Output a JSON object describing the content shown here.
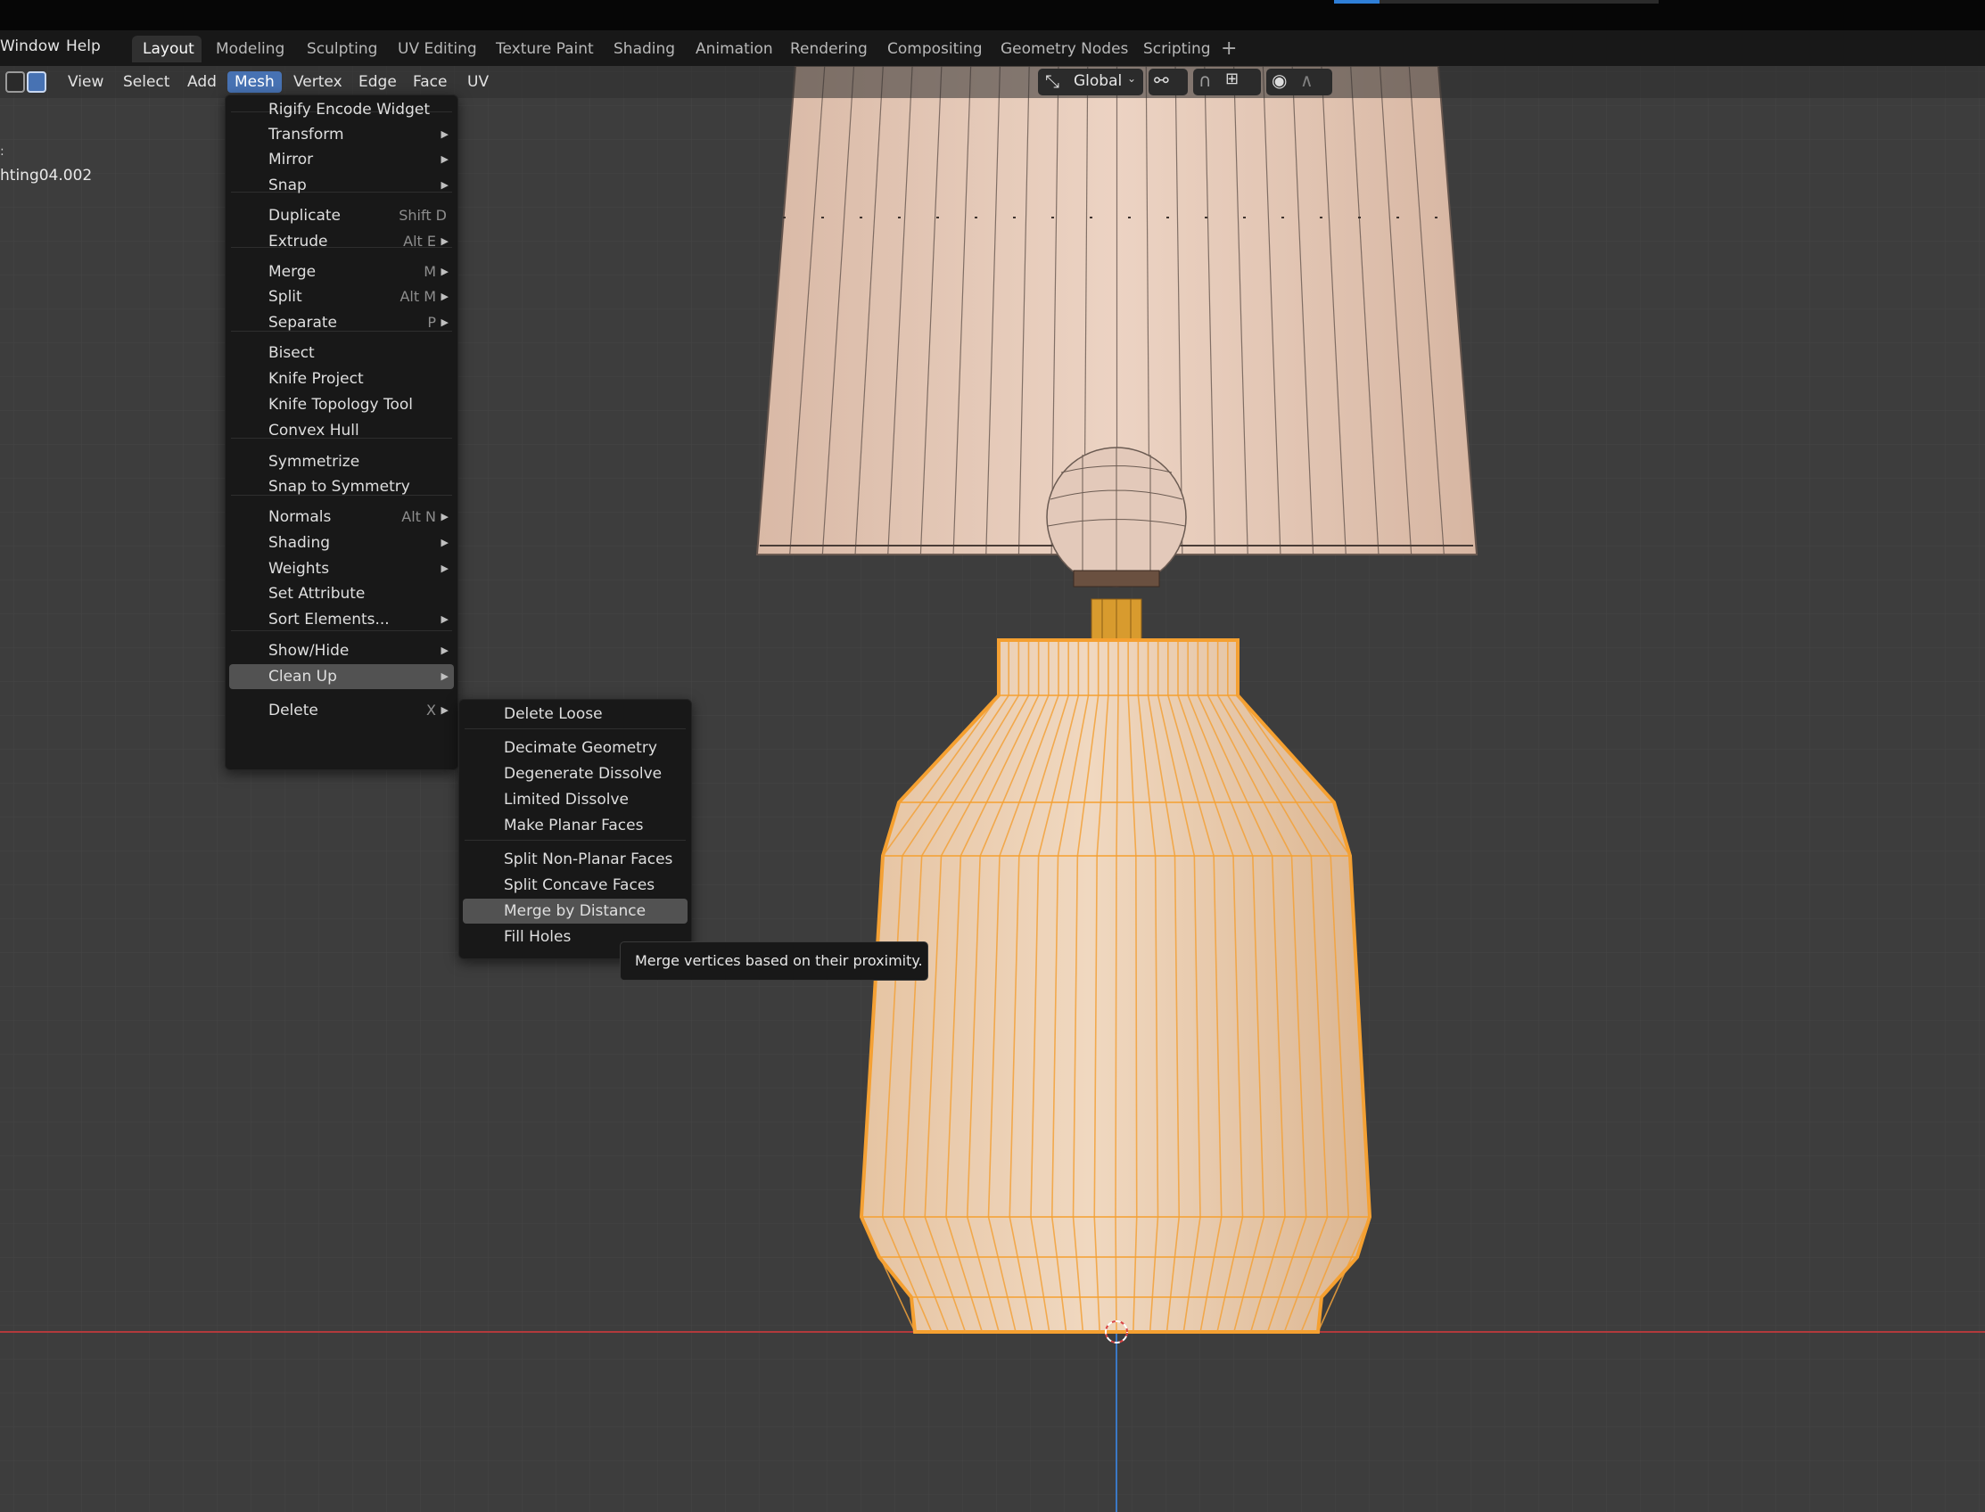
{
  "topbar": {
    "progress_fraction": 0.14
  },
  "menubar": {
    "left_items": [
      "Window",
      "Help"
    ],
    "workspace_tabs": [
      "Layout",
      "Modeling",
      "Sculpting",
      "UV Editing",
      "Texture Paint",
      "Shading",
      "Animation",
      "Rendering",
      "Compositing",
      "Geometry Nodes",
      "Scripting"
    ],
    "active_tab": "Layout",
    "add_icon": "plus-icon"
  },
  "viewport_header": {
    "menus": [
      "View",
      "Select",
      "Add",
      "Mesh",
      "Vertex",
      "Edge",
      "Face",
      "UV"
    ],
    "open_menu": "Mesh",
    "transform_orientation": "Global",
    "icons": [
      "vertex-select-icon",
      "edge-select-icon",
      "transform-orientation-icon",
      "pivot-icon",
      "snap-icon",
      "snap-target-icon",
      "proportional-edit-icon",
      "falloff-icon"
    ]
  },
  "viewport": {
    "object_name": "hting04.002",
    "left_mark": ":",
    "colors": {
      "selection": "#f5a030",
      "axis_x": "#c0393b",
      "axis_z": "#3b78c4",
      "grid": "#434343",
      "lampshade": "#dcbcaa"
    }
  },
  "mesh_menu": {
    "items": [
      {
        "label": "Rigify Encode Widget",
        "shortcut": "",
        "submenu": false
      },
      {
        "label": "Transform",
        "shortcut": "",
        "submenu": true
      },
      {
        "label": "Mirror",
        "shortcut": "",
        "submenu": true
      },
      {
        "label": "Snap",
        "shortcut": "",
        "submenu": true
      },
      {
        "label": "Duplicate",
        "shortcut": "Shift D",
        "submenu": false
      },
      {
        "label": "Extrude",
        "shortcut": "Alt E",
        "submenu": true
      },
      {
        "label": "Merge",
        "shortcut": "M",
        "submenu": true
      },
      {
        "label": "Split",
        "shortcut": "Alt M",
        "submenu": true
      },
      {
        "label": "Separate",
        "shortcut": "P",
        "submenu": true
      },
      {
        "label": "Bisect",
        "shortcut": "",
        "submenu": false
      },
      {
        "label": "Knife Project",
        "shortcut": "",
        "submenu": false
      },
      {
        "label": "Knife Topology Tool",
        "shortcut": "",
        "submenu": false
      },
      {
        "label": "Convex Hull",
        "shortcut": "",
        "submenu": false
      },
      {
        "label": "Symmetrize",
        "shortcut": "",
        "submenu": false
      },
      {
        "label": "Snap to Symmetry",
        "shortcut": "",
        "submenu": false
      },
      {
        "label": "Normals",
        "shortcut": "Alt N",
        "submenu": true
      },
      {
        "label": "Shading",
        "shortcut": "",
        "submenu": true
      },
      {
        "label": "Weights",
        "shortcut": "",
        "submenu": true
      },
      {
        "label": "Set Attribute",
        "shortcut": "",
        "submenu": false
      },
      {
        "label": "Sort Elements...",
        "shortcut": "",
        "submenu": true
      },
      {
        "label": "Show/Hide",
        "shortcut": "",
        "submenu": true
      },
      {
        "label": "Clean Up",
        "shortcut": "",
        "submenu": true
      },
      {
        "label": "Delete",
        "shortcut": "X",
        "submenu": true
      }
    ],
    "highlighted": "Clean Up"
  },
  "cleanup_menu": {
    "items": [
      {
        "label": "Delete Loose"
      },
      {
        "label": "Decimate Geometry"
      },
      {
        "label": "Degenerate Dissolve"
      },
      {
        "label": "Limited Dissolve"
      },
      {
        "label": "Make Planar Faces"
      },
      {
        "label": "Split Non-Planar Faces"
      },
      {
        "label": "Split Concave Faces"
      },
      {
        "label": "Merge by Distance"
      },
      {
        "label": "Fill Holes"
      }
    ],
    "highlighted": "Merge by Distance"
  },
  "tooltip": {
    "text": "Merge vertices based on their proximity."
  }
}
